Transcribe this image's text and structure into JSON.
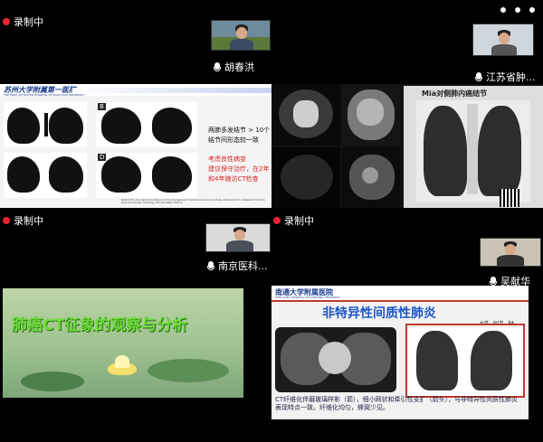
{
  "window": {
    "controls": [
      "minimize",
      "maximize",
      "close"
    ]
  },
  "recording_label": "录制中",
  "participants": [
    {
      "name": "胡春洪"
    },
    {
      "name": "江苏省肿..."
    },
    {
      "name": "南京医科..."
    },
    {
      "name": "吴献华"
    }
  ],
  "slide_top_left": {
    "header": "苏州大学附属第一医院",
    "header_en": "THE FIRST AFFILIATED HOSPITAL OF SOOCHOW UNIVERSITY",
    "panel_labels": [
      "B",
      "D"
    ],
    "text_line1": "两肺多发结节 > 10个",
    "text_line2": "结节间形态较一致",
    "text_red1": "考虑良性病变",
    "text_red2": "建议保守治疗，在2年",
    "text_red3": "和4年随访CT检查",
    "reference": "Naidich DP, et al. Recommendations for the management of subsolid pulmonary nodules detected at CT: a statement from the Fleischner Society. Radiology. 2013 Jan;266(1):304-17."
  },
  "slide_top_right": {
    "title": "Mia对侧肺内癌结节"
  },
  "slide_bottom_left": {
    "title": "肺癌CT征象的观察与分析"
  },
  "slide_bottom_right": {
    "header": "南通大学附属医院",
    "header_en": "AFFILIATED HOSPITAL OF NANTONG UNIVERSITY",
    "title": "非特异性间质性肺炎",
    "patient": "女性，60岁，RA。",
    "caption": "CT纤维化伴磨玻璃样影（箭），细小网状和牵引性支扩（箭头），与非特异性间质性肺炎表现特点一致。纤维化均匀，蜂窝少见。"
  },
  "colors": {
    "record_dot": "#e22233",
    "slide_title_green": "#6ddc3a",
    "slide_title_blue": "#1a56c7",
    "red_text": "#d92424"
  }
}
